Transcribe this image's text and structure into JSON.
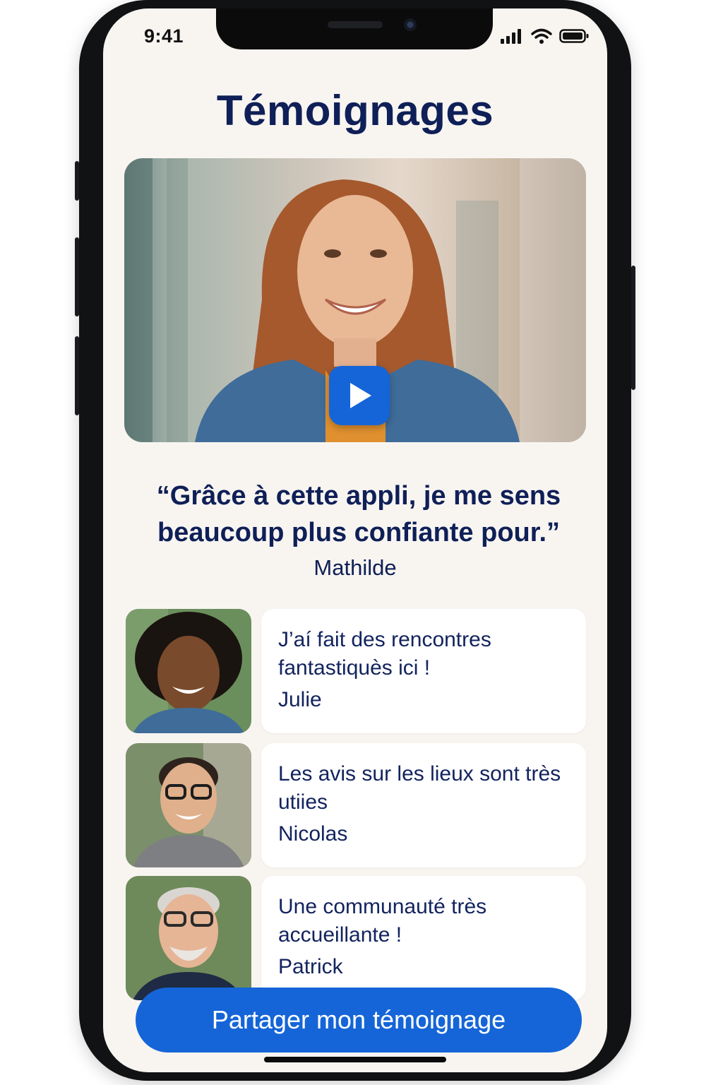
{
  "status_bar": {
    "time": "9:41"
  },
  "title": "Témoignages",
  "featured": {
    "quote": "“Grâce à cette appli, je me sens beaucoup plus confiante pour.”",
    "author": "Mathilde"
  },
  "testimonials": [
    {
      "text": "J’aí fait des rencontres fantastiquès ici !",
      "name": "Julie"
    },
    {
      "text": "Les avis sur les lieux sont très utiies",
      "name": "Nicolas"
    },
    {
      "text": "Une communauté très accueillante !",
      "name": "Patrick"
    }
  ],
  "share_button": "Partager mon témoignage",
  "colors": {
    "primary": "#1565d8",
    "navy": "#0f1f57",
    "background": "#f8f5f1"
  }
}
